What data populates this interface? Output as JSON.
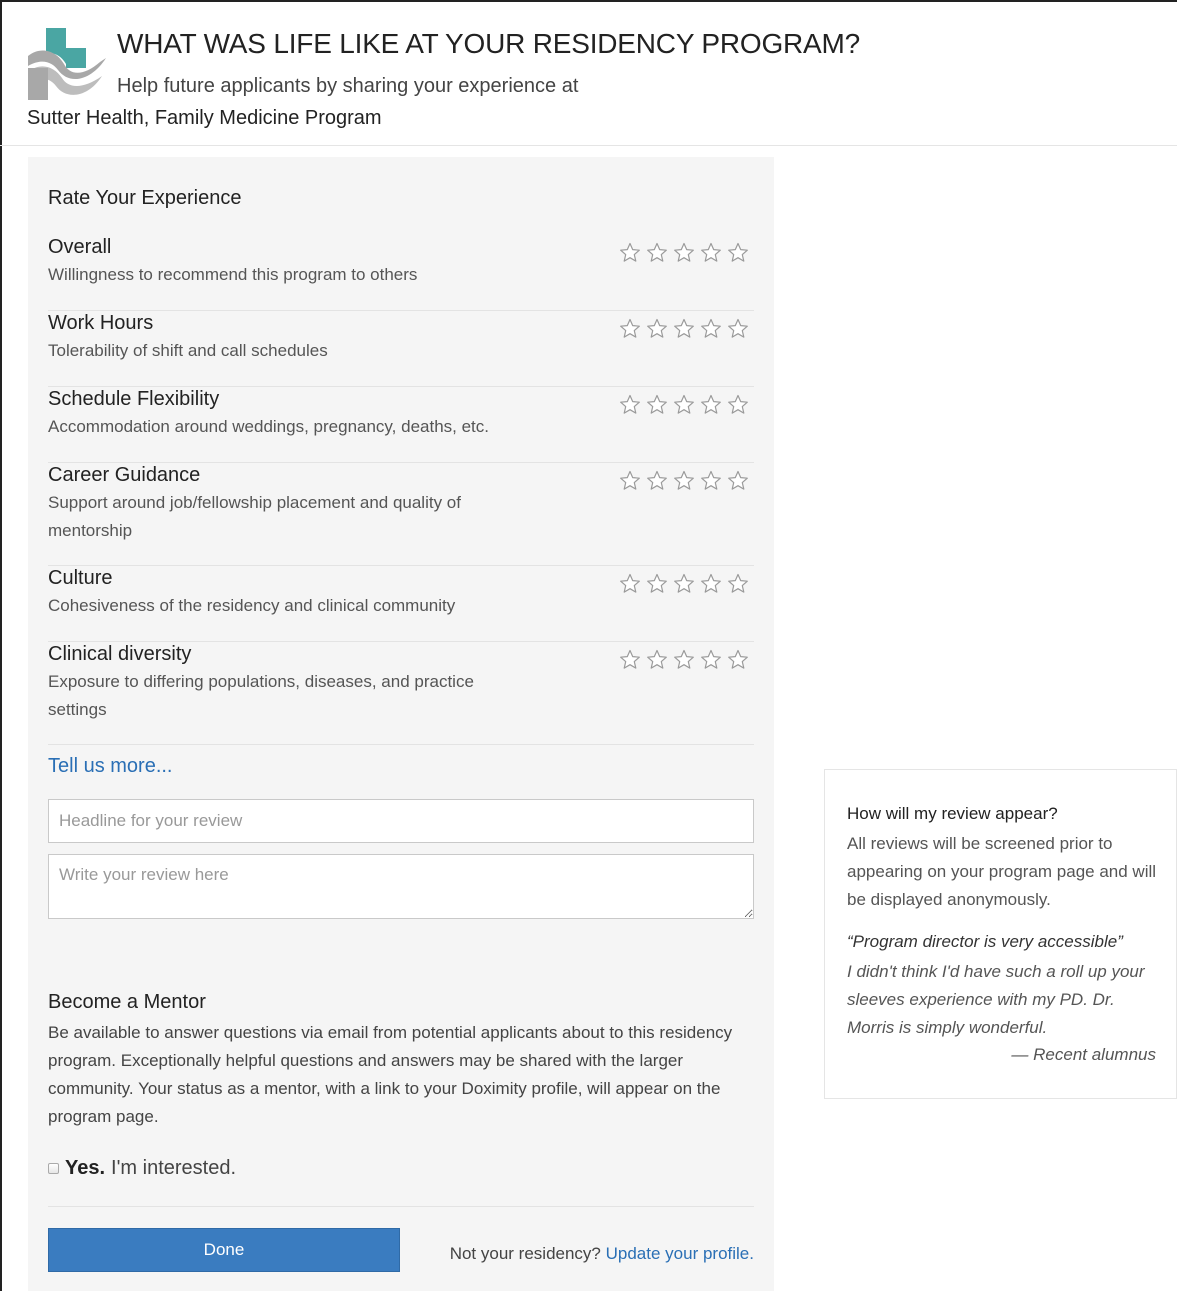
{
  "header": {
    "title": "WHAT WAS LIFE LIKE AT YOUR RESIDENCY PROGRAM?",
    "subtitle": "Help future applicants by sharing your experience at",
    "program": "Sutter Health, Family Medicine Program",
    "logo_icon": "sutter-health-logo-icon"
  },
  "rate": {
    "title": "Rate Your Experience",
    "max_stars": 5,
    "items": [
      {
        "name": "Overall",
        "desc": "Willingness to recommend this program to others",
        "rating": 0
      },
      {
        "name": "Work Hours",
        "desc": "Tolerability of shift and call schedules",
        "rating": 0
      },
      {
        "name": "Schedule Flexibility",
        "desc": "Accommodation around weddings, pregnancy, deaths, etc.",
        "rating": 0
      },
      {
        "name": "Career Guidance",
        "desc": "Support around job/fellowship placement and quality of mentorship",
        "rating": 0
      },
      {
        "name": "Culture",
        "desc": "Cohesiveness of the residency and clinical community",
        "rating": 0
      },
      {
        "name": "Clinical diversity",
        "desc": "Exposure to differing populations, diseases, and practice settings",
        "rating": 0
      }
    ]
  },
  "review": {
    "tell_more": "Tell us more...",
    "headline_placeholder": "Headline for your review",
    "headline_value": "",
    "body_placeholder": "Write your review here",
    "body_value": ""
  },
  "mentor": {
    "title": "Become a Mentor",
    "text": "Be available to answer questions via email from potential applicants about to this residency program. Exceptionally helpful questions and answers may be shared with the larger community. Your status as a mentor, with a link to your Doximity profile, will appear on the program page.",
    "yes_label": "Yes.",
    "interest_label": "I'm interested.",
    "checked": false
  },
  "footer": {
    "done_label": "Done",
    "not_yours_text": "Not your residency?",
    "update_link": "Update your profile."
  },
  "sidebar": {
    "question": "How will my review appear?",
    "answer": "All reviews will be screened prior to appearing on your program page and will be displayed anonymously.",
    "quote_headline": "“Program director is very accessible”",
    "quote_body": "I didn't think I'd have such a roll up your sleeves experience with my PD. Dr. Morris is simply wonderful.",
    "quote_attribution": "— Recent alumnus"
  },
  "colors": {
    "accent": "#3a7cc0",
    "link": "#2a6fb5",
    "panel_bg": "#f5f5f5",
    "logo_teal": "#4aa6a3",
    "logo_gray": "#a8a8a8"
  }
}
